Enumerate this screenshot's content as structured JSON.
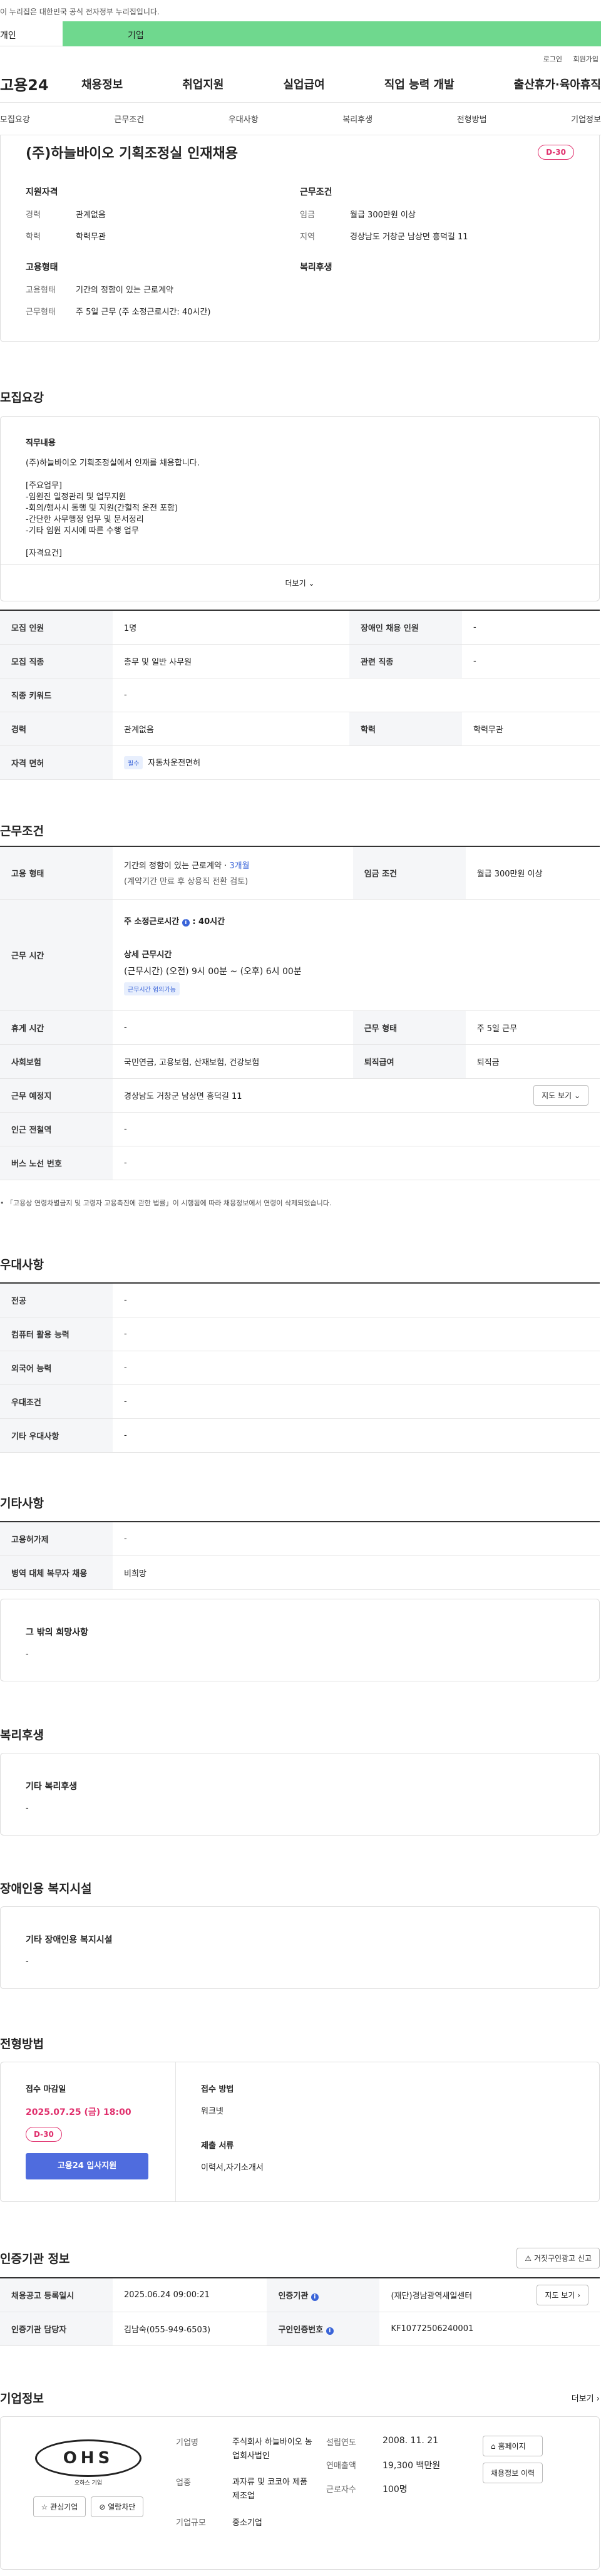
{
  "top": {
    "notice": "이 누리집은 대한민국 공식 전자정부 누리집입니다.",
    "tab_personal": "개인",
    "tab_company": "기업"
  },
  "util": {
    "login": "로그인",
    "join": "회원가입"
  },
  "gnb": {
    "logo": "고용24",
    "menu": [
      "채용정보",
      "취업지원",
      "실업급여",
      "직업 능력 개발",
      "출산휴가·육아휴직"
    ]
  },
  "anchors": [
    "모집요강",
    "근무조건",
    "우대사항",
    "복리후생",
    "전형방법",
    "기업정보"
  ],
  "job": {
    "title": "(주)하늘바이오 기획조정실 인재채용",
    "dday": "D-30"
  },
  "summary": {
    "qual_title": "지원자격",
    "career_k": "경력",
    "career_v": "관계없음",
    "edu_k": "학력",
    "edu_v": "학력무관",
    "cond_title": "근무조건",
    "wage_k": "임금",
    "wage_v": "월급 300만원 이상",
    "region_k": "지역",
    "region_v": "경상남도 거창군 남상면 흥덕길 11",
    "emp_title": "고용형태",
    "etype_k": "고용형태",
    "etype_v": "기간의 정함이 있는 근로계약",
    "wtype_k": "근무형태",
    "wtype_v": "주 5일 근무 (주 소정근로시간: 40시간)",
    "welfare_title": "복리후생"
  },
  "recruit": {
    "section": "모집요강",
    "duty_title": "직무내용",
    "duty_lines": [
      "(주)하늘바이오 기획조정실에서 인재를 채용합니다.",
      "",
      "[주요업무]",
      "-임원진 일정관리 및 업무지원",
      "-회의/행사시 동행 및 지원(간헐적 운전 포함)",
      "-간단한 사무행정 업무 및 문서정리",
      "-기타 임원 지시에 따른 수행 업무",
      "",
      "[자격요건]"
    ],
    "more": "더보기",
    "rows": [
      [
        "모집 인원",
        "1명",
        "장애인 채용 인원",
        "-"
      ],
      [
        "모집 직종",
        "총무 및 일반 사무원",
        "관련 직종",
        "-"
      ],
      [
        "직종 키워드",
        "-"
      ],
      [
        "경력",
        "관계없음",
        "학력",
        "학력무관"
      ],
      [
        "자격 면허",
        "자동차운전면허"
      ]
    ],
    "license_badge": "필수"
  },
  "cond": {
    "section": "근무조건",
    "emp_k": "고용 형태",
    "emp_v1": "기간의 정함이 있는 근로계약 · ",
    "emp_v1b": "3개월",
    "emp_v2": "(계약기간 만료 후 상용직 전환 검토)",
    "wage_k": "임금 조건",
    "wage_v": "월급 300만원 이상",
    "hours_k": "근무 시간",
    "hours_v1": "주 소정근로시간",
    "hours_v1b": ": 40시간",
    "hours_v2": "상세 근무시간",
    "hours_v3": "(근무시간) (오전) 9시 00분 ~ (오후) 6시 00분",
    "hours_badge": "근무시간 협의가능",
    "holiday_k": "휴게 시간",
    "holiday_v": "-",
    "wform_k": "근무 형태",
    "wform_v": "주 5일 근무",
    "ins_k": "사회보험",
    "ins_v": "국민연금, 고용보험, 산재보험, 건강보험",
    "retire_k": "퇴직급여",
    "retire_v": "퇴직금",
    "place_k": "근무 예정지",
    "place_v": "경상남도 거창군 남상면 흥덕길 11",
    "map": "지도 보기",
    "subway_k": "인근 전철역",
    "subway_v": "-",
    "bus_k": "버스 노선 번호",
    "bus_v": "-",
    "footnote": "「고용상 연령차별금지 및 고령자 고용촉진에 관한 법률」이 시행됨에 따라 채용정보에서 연령이 삭제되었습니다."
  },
  "pref": {
    "section": "우대사항",
    "rows": [
      [
        "전공",
        "-"
      ],
      [
        "컴퓨터 활용 능력",
        "-"
      ],
      [
        "외국어 능력",
        "-"
      ],
      [
        "우대조건",
        "-"
      ],
      [
        "기타 우대사항",
        "-"
      ]
    ]
  },
  "etc": {
    "section": "기타사항",
    "rows": [
      [
        "고용허가제",
        "-"
      ],
      [
        "병역 대체 복무자 채용",
        "비희망"
      ]
    ],
    "wish_title": "그 밖의 희망사항",
    "wish_v": "-"
  },
  "welfare": {
    "section": "복리후생",
    "title": "기타 복리후생",
    "v": "-"
  },
  "disabled": {
    "section": "장애인용 복지시설",
    "title": "기타 장애인용 복지시설",
    "v": "-"
  },
  "process": {
    "section": "전형방법",
    "deadline_k": "접수 마감일",
    "deadline_v": "2025.07.25 (금) 18:00",
    "dday": "D-30",
    "apply": "고용24 입사지원",
    "method_k": "접수 방법",
    "method_v": "워크넷",
    "doc_k": "제출 서류",
    "doc_v": "이력서,자기소개서"
  },
  "agency": {
    "section": "인증기관 정보",
    "report": "거짓구인광고 신고",
    "reg_k": "채용공고 등록일시",
    "reg_v": "2025.06.24 09:00:21",
    "org_k": "인증기관",
    "org_v": "(재단)경남광역새일센터",
    "map": "지도 보기",
    "mgr_k": "인증기관 담당자",
    "mgr_v": "김남숙(055-949-6503)",
    "num_k": "구인인증번호",
    "num_v": "KF10772506240001"
  },
  "company": {
    "section": "기업정보",
    "more": "더보기",
    "logo": "OHS",
    "logo_sub": "오하스 기업",
    "fav": "관심기업",
    "block": "열람차단",
    "name_k": "기업명",
    "name_v": "주식회사 하늘바이오 농업회사법인",
    "ind_k": "업종",
    "ind_v": "과자류 및 코코아 제품 제조업",
    "size_k": "기업규모",
    "size_v": "중소기업",
    "est_k": "설립연도",
    "est_v": "2008. 11. 21",
    "sales_k": "연매출액",
    "sales_v": "19,300 백만원",
    "emp_k": "근로자수",
    "emp_v": "100명",
    "home": "홈페이지",
    "hist": "채용정보 이력"
  }
}
